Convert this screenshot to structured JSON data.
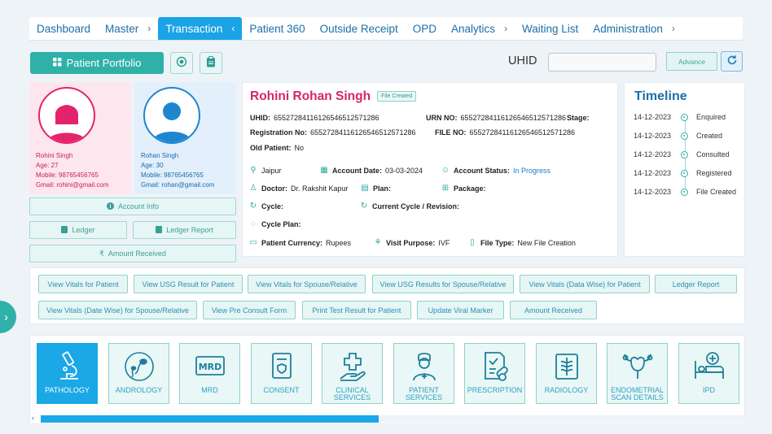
{
  "nav": {
    "items": [
      {
        "label": "Dashboard",
        "chevron": ""
      },
      {
        "label": "Master",
        "chevron": "›"
      },
      {
        "label": "Transaction",
        "chevron": "‹"
      },
      {
        "label": "Patient 360",
        "chevron": ""
      },
      {
        "label": "Outside Receipt",
        "chevron": ""
      },
      {
        "label": "OPD",
        "chevron": ""
      },
      {
        "label": "Analytics",
        "chevron": "›"
      },
      {
        "label": "Waiting List",
        "chevron": ""
      },
      {
        "label": "Administration",
        "chevron": "›"
      }
    ]
  },
  "toolbar": {
    "portfolio_label": "Patient Portfolio",
    "uhid_label": "UHID",
    "uhid_value": "",
    "advance_label": "Advance"
  },
  "female": {
    "name": "Rohini Singh",
    "age": "Age: 27",
    "mobile": "Mobile: 98765456765",
    "email": "Gmail: rohini@gmail.com"
  },
  "male": {
    "name": "Rohan Singh",
    "age": "Age: 30",
    "mobile": "Mobile: 98765456765",
    "email": "Gmail: rohan@gmail.com"
  },
  "side_buttons": {
    "account_info": "Account Info",
    "ledger": "Ledger",
    "ledger_report": "Ledger Report",
    "amount_received": "Amount Received"
  },
  "details": {
    "patient_name": "Rohini Rohan Singh",
    "status_badge": "File Created",
    "uhid_label": "UHID:",
    "uhid": "655272841161265465125712​86",
    "urn_label": "URN NO:",
    "urn": "65527284116126546512571286",
    "stage_label": "Stage:",
    "reg_label": "Registration No:",
    "reg": "65527284116126546512571286",
    "file_label": "FILE NO:",
    "file": "65527284116126546512571286",
    "old_label": "Old Patient:",
    "old": "No",
    "city": "Jaipur",
    "account_date_label": "Account Date:",
    "account_date": "03-03-2024",
    "account_status_label": "Account Status:",
    "account_status": "In Progress",
    "doctor_label": "Doctor:",
    "doctor": "Dr. Rakshit Kapur",
    "plan_label": "Plan:",
    "package_label": "Package:",
    "cycle_label": "Cycle:",
    "current_cycle_label": "Current Cycle / Revision:",
    "cycle_plan_label": "Cycle Plan:",
    "currency_label": "Patient Currency:",
    "currency": "Rupees",
    "visit_label": "Visit Purpose:",
    "visit": "IVF",
    "filetype_label": "File Type:",
    "filetype": "New File Creation"
  },
  "timeline": {
    "title": "Timeline",
    "events": [
      {
        "date": "14-12-2023",
        "label": "Enquired"
      },
      {
        "date": "14-12-2023",
        "label": "Created"
      },
      {
        "date": "14-12-2023",
        "label": "Consulted"
      },
      {
        "date": "14-12-2023",
        "label": "Registered"
      },
      {
        "date": "14-12-2023",
        "label": "File Created"
      }
    ]
  },
  "actions": [
    "View Vitals for Patient",
    "View USG Result for Patient",
    "View Vitals for Spouse/Relative",
    "View USG Results for Spouse/Relative",
    "View Vitals (Data Wise) for Patient",
    "Ledger Report",
    "View Vitals (Date Wise) for Spouse/Relative",
    "View Pre Consult Form",
    "Print Test Result for Patient",
    "Update Viral Marker",
    "Amount Received"
  ],
  "tiles": [
    "PATHOLOGY",
    "ANDROLOGY",
    "MRD",
    "CONSENT",
    "CLINICAL SERVICES",
    "PATIENT SERVICES",
    "PRESCRIPTION",
    "RADIOLOGY",
    "ENDOMETRIAL SCAN DETAILS",
    "IPD"
  ],
  "mrd_icon_text": "MRD",
  "scroll_fraction": 0.48
}
